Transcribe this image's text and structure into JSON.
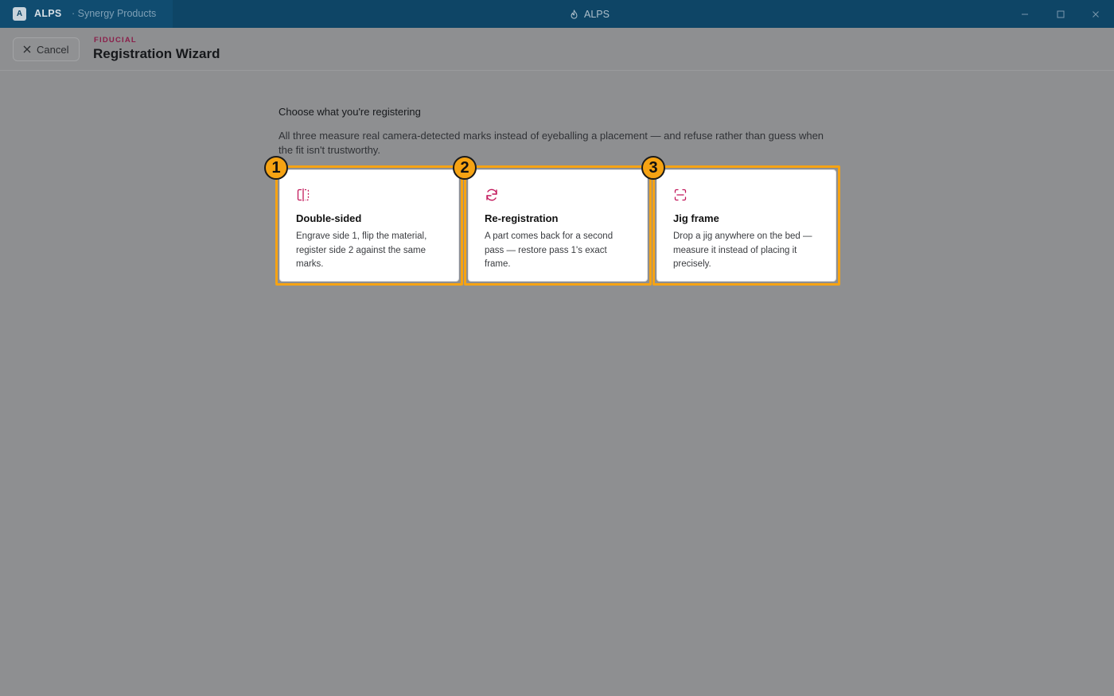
{
  "titlebar": {
    "app_badge": "A",
    "app_name": "ALPS",
    "org": "· Synergy Products",
    "window_title": "ALPS",
    "window_icon": "flame-icon"
  },
  "header": {
    "cancel_label": "Cancel",
    "kicker": "FIDUCIAL",
    "title": "Registration Wizard"
  },
  "main": {
    "prompt": "Choose what you're registering",
    "description": "All three measure real camera-detected marks instead of eyeballing a placement — and refuse rather than guess when the fit isn't trustworthy.",
    "cards": [
      {
        "badge": "1",
        "icon": "split-flip-icon",
        "title": "Double-sided",
        "desc": "Engrave side 1, flip the material, register side 2 against the same marks."
      },
      {
        "badge": "2",
        "icon": "refresh-icon",
        "title": "Re-registration",
        "desc": "A part comes back for a second pass — restore pass 1's exact frame."
      },
      {
        "badge": "3",
        "icon": "scan-frame-icon",
        "title": "Jig frame",
        "desc": "Drop a jig anywhere on the bed — measure it instead of placing it precisely."
      }
    ]
  },
  "colors": {
    "titlebar": "#0e4566",
    "accent": "#c2185b",
    "highlight": "#f6a313",
    "overlay_bg": "#8e8f91"
  }
}
